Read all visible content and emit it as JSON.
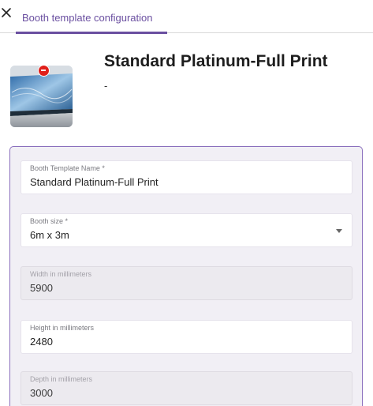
{
  "tab": {
    "label": "Booth template configuration"
  },
  "header": {
    "title": "Standard Platinum-Full Print",
    "subtitle": "-"
  },
  "form": {
    "template_name": {
      "label": "Booth Template Name *",
      "value": "Standard Platinum-Full Print"
    },
    "booth_size": {
      "label": "Booth size *",
      "value": "6m x 3m"
    },
    "width": {
      "label": "Width in millimeters",
      "value": "5900"
    },
    "height": {
      "label": "Height in millimeters",
      "value": "2480"
    },
    "depth": {
      "label": "Depth in millimeters",
      "value": "3000"
    }
  },
  "colors": {
    "accent": "#6a4fa0",
    "remove": "#e0201b"
  }
}
